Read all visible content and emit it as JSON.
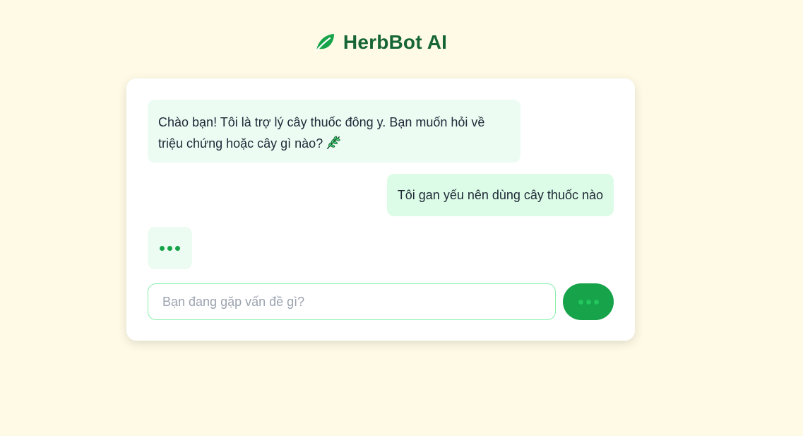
{
  "header": {
    "title": "HerbBot AI",
    "icon": "leaf-icon"
  },
  "chat": {
    "messages": [
      {
        "role": "bot",
        "text": "Chào bạn! Tôi là trợ lý cây thuốc đông y. Bạn muốn hỏi về triệu chứng hoặc cây gì nào?",
        "icon": "herb-icon"
      },
      {
        "role": "user",
        "text": "Tôi gan yếu nên dùng cây thuốc nào"
      }
    ],
    "typing_indicator": "loading-dots"
  },
  "composer": {
    "placeholder": "Bạn đang gặp vấn đề gì?",
    "value": "",
    "send_button_state": "loading-dots"
  },
  "colors": {
    "background": "#fefae6",
    "accent": "#16a34a",
    "title": "#166534",
    "bot_bubble": "#edfcf3",
    "user_bubble": "#dcfce7"
  }
}
